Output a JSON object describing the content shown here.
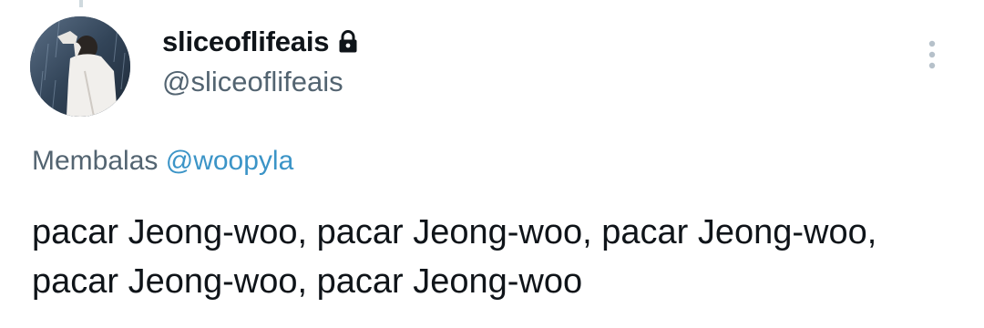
{
  "tweet": {
    "display_name": "sliceoflifeais",
    "handle": "@sliceoflifeais",
    "reply_prefix": "Membalas",
    "reply_mention": "@woopyla",
    "text": "pacar Jeong-woo, pacar Jeong-woo, pacar Jeong-woo, pacar Jeong-woo, pacar Jeong-woo"
  },
  "icons": {
    "protected": "lock-icon",
    "menu": "more-vertical-icon",
    "avatar": "avatar"
  },
  "colors": {
    "text_primary": "#0f1419",
    "text_secondary": "#536471",
    "mention": "#3b94c7",
    "more_icon": "#b6c1ca"
  }
}
